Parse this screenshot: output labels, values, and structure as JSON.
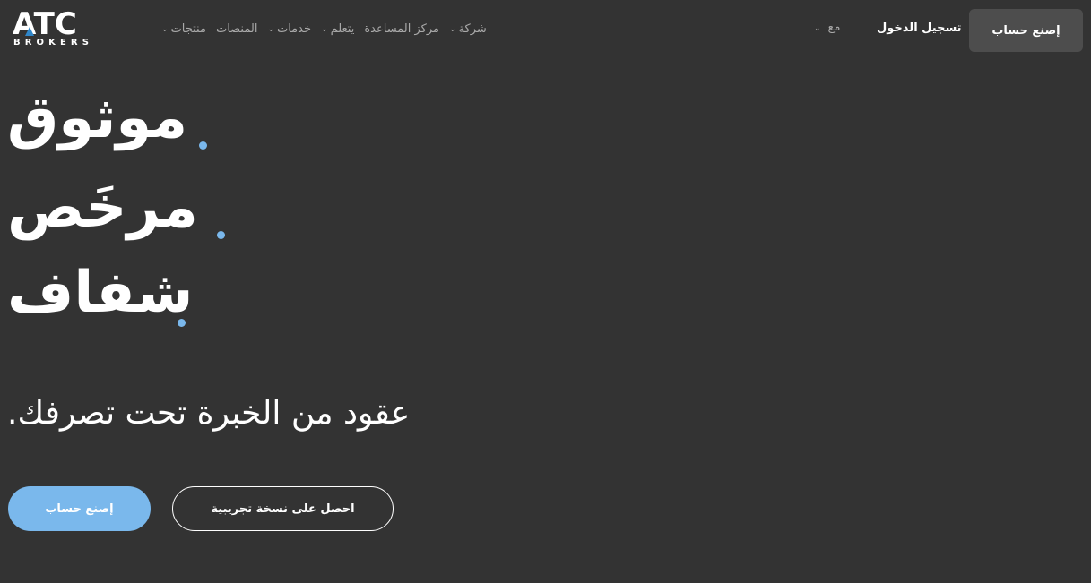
{
  "header": {
    "logo": {
      "main": "ATC",
      "sub": "BROKERS"
    },
    "nav": [
      {
        "label": "شركة",
        "has_dropdown": true
      },
      {
        "label": "مركز المساعدة",
        "has_dropdown": false
      },
      {
        "label": "يتعلم",
        "has_dropdown": true
      },
      {
        "label": "خدمات",
        "has_dropdown": true
      },
      {
        "label": "المنصات",
        "has_dropdown": false
      },
      {
        "label": "منتجات",
        "has_dropdown": true
      }
    ],
    "language_label": "مع",
    "login_label": "تسجيل الدخول",
    "signup_label": "إصنع حساب"
  },
  "hero": {
    "lines": [
      "موثوق",
      "مرخَص",
      "شفاف"
    ],
    "dot_color": "#7ab8ec",
    "tagline": "عقود من الخبرة تحت تصرفك.",
    "cta_primary": "إصنع حساب",
    "cta_secondary": "احصل على نسخة تجريبية"
  },
  "colors": {
    "background": "#333333",
    "accent": "#7ab8ec",
    "nav_text": "#a9a9a9",
    "button_dark": "#4d4d4d"
  }
}
